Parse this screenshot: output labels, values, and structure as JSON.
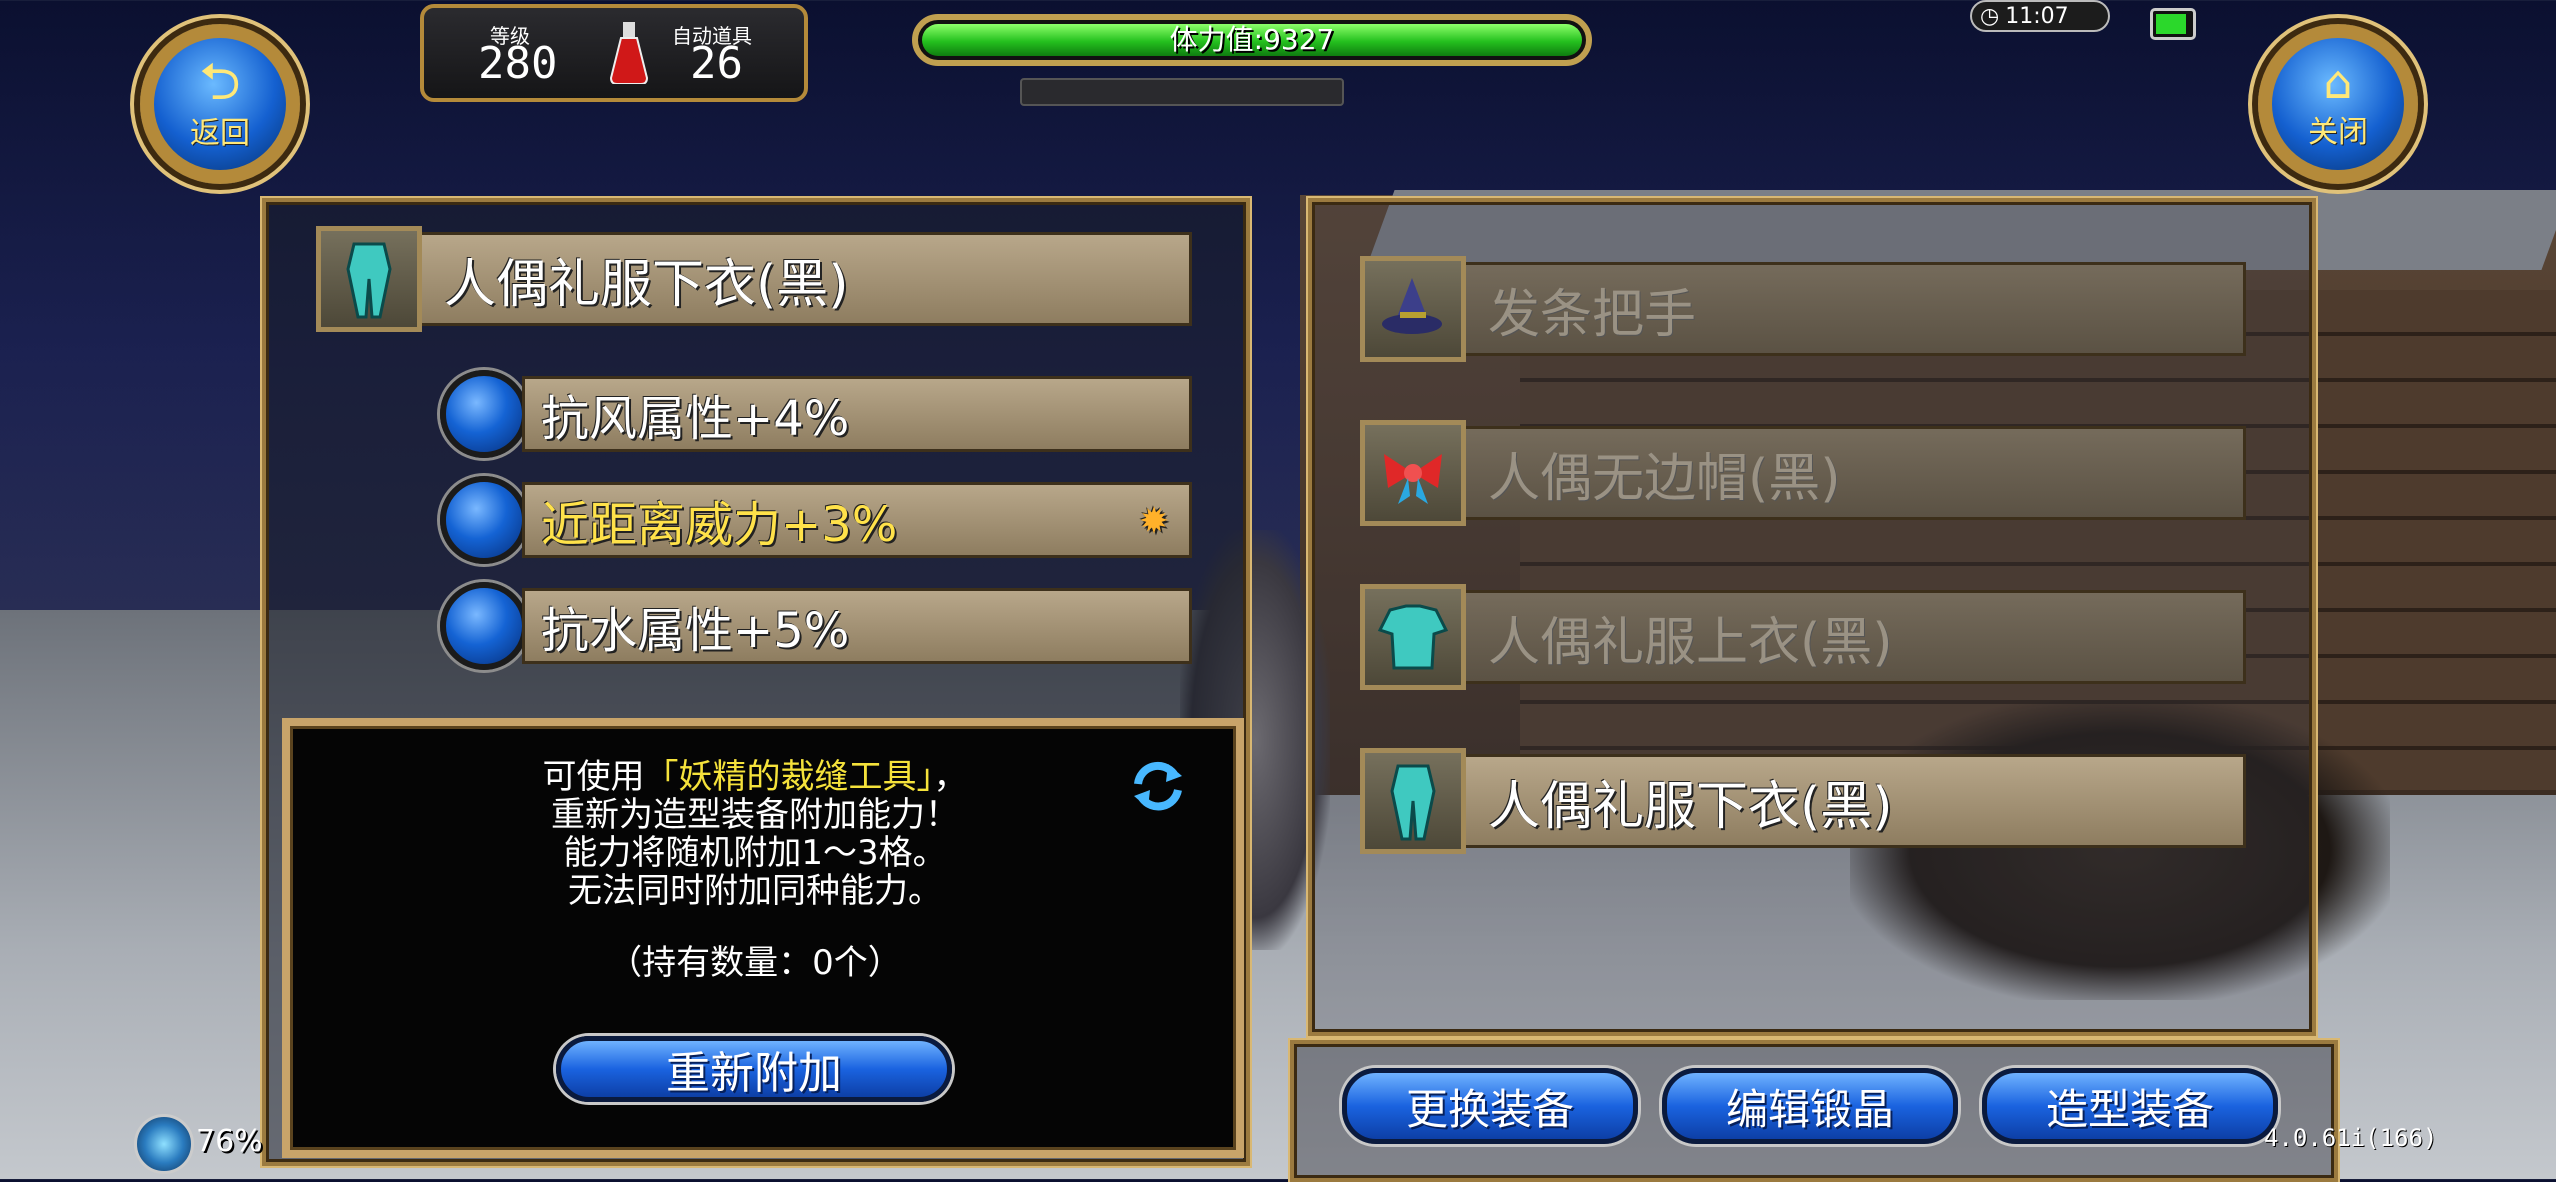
{
  "top_left": {
    "back_label": "返回"
  },
  "top_right": {
    "close_label": "关闭"
  },
  "stats": {
    "level_label": "等级",
    "level_value": "280",
    "auto_item_label": "自动道具",
    "auto_item_value": "26"
  },
  "stamina": {
    "label": "体力值:9327",
    "fill_fraction": 1.0
  },
  "status": {
    "time": "11:07",
    "battery_color": "#2bd82b"
  },
  "left_panel": {
    "item_name": "人偶礼服下衣(黑)",
    "item_icon": "armor-lower-icon",
    "attributes": [
      {
        "label": "抗风属性+4%",
        "highlight": false
      },
      {
        "label": "近距离威力+3%",
        "highlight": true,
        "starred": true
      },
      {
        "label": "抗水属性+5%",
        "highlight": false
      }
    ]
  },
  "info": {
    "line1_pre": "可使用",
    "line1_tool": "「妖精的裁缝工具」",
    "line1_post": "，",
    "line2": "重新为造型装备附加能力！",
    "line3": "能力将随机附加1～3格。",
    "line4": "无法同时附加同种能力。",
    "quantity": "（持有数量：0个）",
    "reattach_button": "重新附加"
  },
  "right_panel": {
    "items": [
      {
        "name": "发条把手",
        "icon": "witch-hat-icon",
        "dim": true
      },
      {
        "name": "人偶无边帽(黑)",
        "icon": "ribbon-icon",
        "dim": true
      },
      {
        "name": "人偶礼服上衣(黑)",
        "icon": "armor-upper-icon",
        "dim": true
      },
      {
        "name": "人偶礼服下衣(黑)",
        "icon": "armor-lower-icon",
        "dim": false
      }
    ]
  },
  "bottom_buttons": {
    "change_equipment": "更换装备",
    "edit_crystal": "编辑锻晶",
    "style_equipment": "造型装备"
  },
  "footer": {
    "percent": "76%",
    "version": "4.0.61i(166)"
  },
  "colors": {
    "accent_gold": "#c8a46a",
    "button_blue": "#1a63e0",
    "highlight_yellow": "#f5e23b"
  }
}
